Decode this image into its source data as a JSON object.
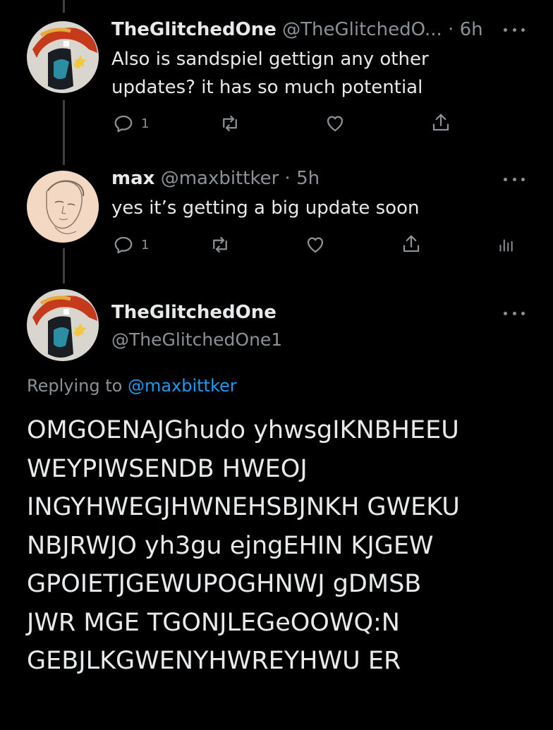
{
  "tweets": [
    {
      "name": "TheGlitchedOne",
      "handle": "@TheGlitchedO...",
      "separator": "·",
      "time": "6h",
      "text": "Also is sandspiel gettign any other updates? it has so much potential",
      "reply_count": "1"
    },
    {
      "name": "max",
      "handle": "@maxbittker",
      "separator": "·",
      "time": "5h",
      "text": "yes it’s getting a big update soon",
      "reply_count": "1"
    }
  ],
  "main_tweet": {
    "name": "TheGlitchedOne",
    "handle": "@TheGlitchedOne1",
    "replying_label": "Replying to",
    "replying_to": "@maxbittker",
    "text": "OMGOENAJGhudo yhwsgIKNBHEEU\nWEYPIWSENDB HWEOJ\nINGYHWEGJHWNEHSBJNKH GWEKU\nNBJRWJO yh3gu ejngEHIN KJGEW\nGPOIETJGEWUPOGHNWJ gDMSB\nJWR MGE TGONJLEGeOOWQ:N\nGEBJLKGWENYHWREYHWU ER"
  },
  "icons": {
    "reply": "reply-icon",
    "retweet": "retweet-icon",
    "like": "heart-icon",
    "share": "share-icon",
    "analytics": "analytics-icon",
    "more": "more-icon"
  },
  "colors": {
    "background": "#000000",
    "text": "#e7e9ea",
    "secondary": "#8b9196",
    "link": "#1d9bf0",
    "thread_line": "#3e4144"
  }
}
